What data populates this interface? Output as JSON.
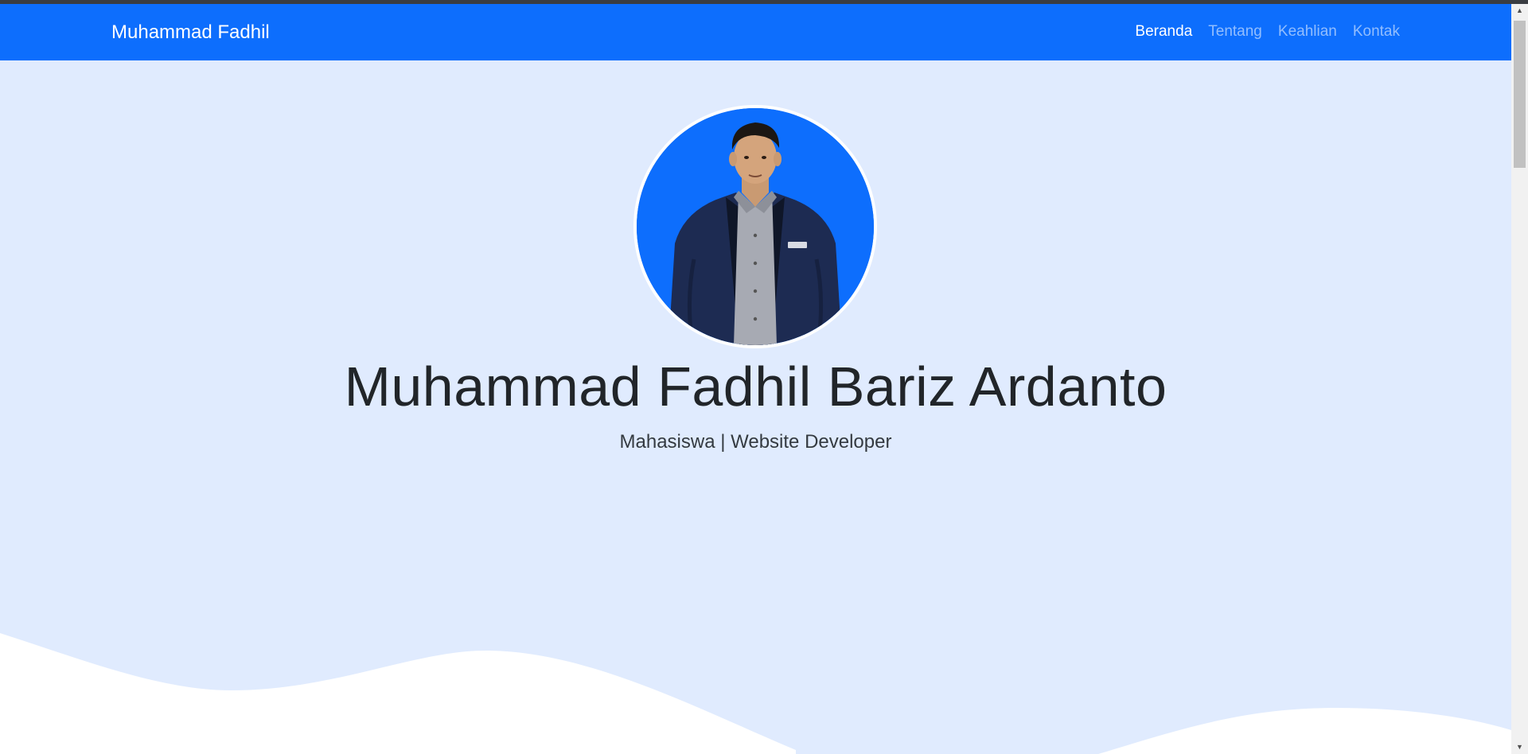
{
  "navbar": {
    "brand": "Muhammad Fadhil",
    "links": [
      {
        "label": "Beranda",
        "active": true
      },
      {
        "label": "Tentang",
        "active": false
      },
      {
        "label": "Keahlian",
        "active": false
      },
      {
        "label": "Kontak",
        "active": false
      }
    ]
  },
  "hero": {
    "title": "Muhammad Fadhil Bariz Ardanto",
    "subtitle": "Mahasiswa | Website Developer"
  },
  "scrollbar": {
    "up_icon": "triangle-up",
    "down_icon": "triangle-down"
  },
  "colors": {
    "primary": "#0d6efd",
    "hero_background": "#e0ebfe",
    "wave": "#ffffff",
    "text": "#212529"
  }
}
